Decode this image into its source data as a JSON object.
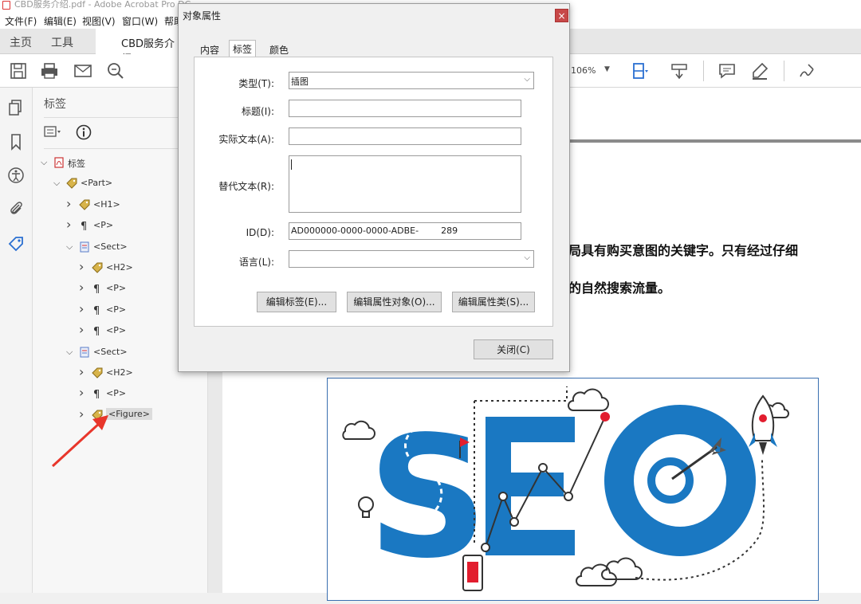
{
  "window": {
    "title": "CBD服务介绍.pdf - Adobe Acrobat Pro DC"
  },
  "menu": [
    "文件(F)",
    "编辑(E)",
    "视图(V)",
    "窗口(W)",
    "帮助"
  ],
  "tabs": {
    "home": "主页",
    "tools": "工具",
    "doc": "CBD服务介绍"
  },
  "toolbar": {
    "zoom": "106%"
  },
  "tags_panel": {
    "title": "标签",
    "tree": [
      {
        "label": "标签",
        "level": 0,
        "icon": "pdf-icon",
        "chev": "down"
      },
      {
        "label": "<Part>",
        "level": 1,
        "icon": "tag-icon",
        "chev": "down"
      },
      {
        "label": "<H1>",
        "level": 2,
        "icon": "tag-icon",
        "chev": "right"
      },
      {
        "label": "<P>",
        "level": 2,
        "icon": "para-icon",
        "chev": "right"
      },
      {
        "label": "<Sect>",
        "level": 2,
        "icon": "sect-icon",
        "chev": "down"
      },
      {
        "label": "<H2>",
        "level": 3,
        "icon": "tag-icon",
        "chev": "right"
      },
      {
        "label": "<P>",
        "level": 3,
        "icon": "para-icon",
        "chev": "right"
      },
      {
        "label": "<P>",
        "level": 3,
        "icon": "para-icon",
        "chev": "right"
      },
      {
        "label": "<P>",
        "level": 3,
        "icon": "para-icon",
        "chev": "right"
      },
      {
        "label": "<Sect>",
        "level": 2,
        "icon": "sect-icon",
        "chev": "down"
      },
      {
        "label": "<H2>",
        "level": 3,
        "icon": "tag-icon",
        "chev": "right"
      },
      {
        "label": "<P>",
        "level": 3,
        "icon": "para-icon",
        "chev": "right"
      },
      {
        "label": "<Figure>",
        "level": 3,
        "icon": "tag-icon",
        "chev": "right"
      }
    ]
  },
  "document": {
    "line1": "局具有购买意图的关键字。只有经过仔细",
    "line2": "的自然搜索流量。",
    "figure_letters": "SEO"
  },
  "dialog": {
    "title": "对象属性",
    "close": "×",
    "tabs": [
      "内容",
      "标签",
      "颜色"
    ],
    "active_tab": "标签",
    "labels": {
      "type": "类型(T):",
      "title": "标题(I):",
      "actual_text": "实际文本(A):",
      "alt_text": "替代文本(R):",
      "id": "ID(D):",
      "language": "语言(L):"
    },
    "values": {
      "type": "插图",
      "title": "",
      "actual_text": "",
      "alt_text": "",
      "id": "AD000000-0000-0000-ADBE-        289",
      "language": ""
    },
    "buttons": {
      "edit_tag": "编辑标签(E)...",
      "edit_attr_obj": "编辑属性对象(O)...",
      "edit_attr_class": "编辑属性类(S)...",
      "close": "关闭(C)"
    }
  },
  "colors": {
    "arrow": "#e8362b",
    "seo_blue": "#1a78c2",
    "accent_red": "#e21d2e"
  }
}
